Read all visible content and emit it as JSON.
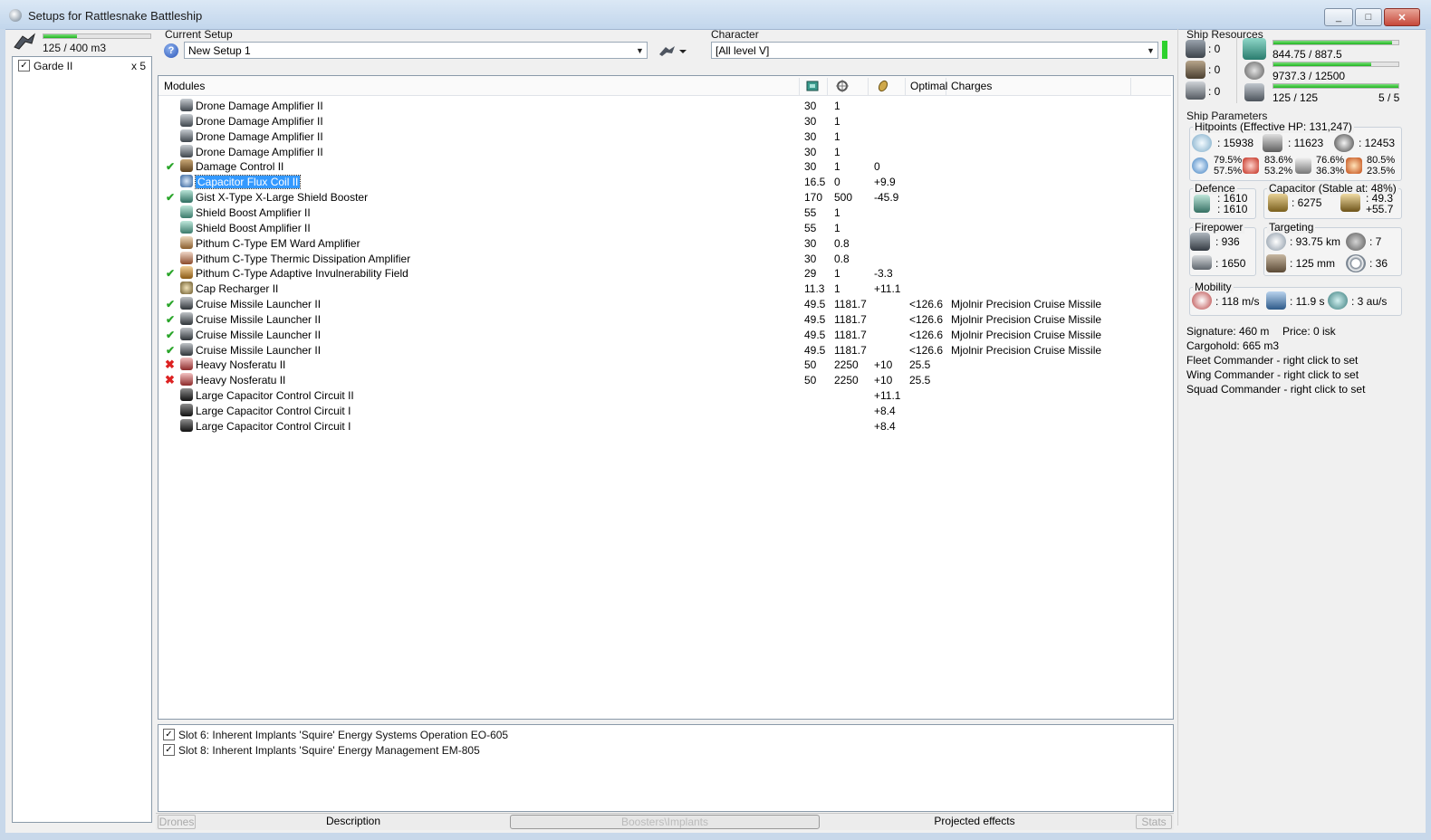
{
  "window": {
    "title": "Setups for Rattlesnake Battleship",
    "min": "_",
    "max": "□",
    "close": "✕"
  },
  "drone_bay": {
    "capacity": "125 / 400 m3",
    "capacity_fraction": 0.3125,
    "items": [
      {
        "name": "Garde II",
        "count": "x 5",
        "checked": true
      }
    ]
  },
  "setup": {
    "label": "Current Setup",
    "value": "New Setup 1"
  },
  "character": {
    "label": "Character",
    "value": "[All level V]"
  },
  "modules": {
    "headers": {
      "modules": "Modules",
      "optimal": "Optimal",
      "charges": "Charges"
    },
    "rows": [
      {
        "status": "",
        "icon": "drone-damage-amplifier-icon",
        "name": "Drone Damage Amplifier II",
        "cpu": "30",
        "pg": "1",
        "cap": "",
        "optimal": "",
        "charge": ""
      },
      {
        "status": "",
        "icon": "drone-damage-amplifier-icon",
        "name": "Drone Damage Amplifier II",
        "cpu": "30",
        "pg": "1",
        "cap": "",
        "optimal": "",
        "charge": ""
      },
      {
        "status": "",
        "icon": "drone-damage-amplifier-icon",
        "name": "Drone Damage Amplifier II",
        "cpu": "30",
        "pg": "1",
        "cap": "",
        "optimal": "",
        "charge": ""
      },
      {
        "status": "",
        "icon": "drone-damage-amplifier-icon",
        "name": "Drone Damage Amplifier II",
        "cpu": "30",
        "pg": "1",
        "cap": "",
        "optimal": "",
        "charge": ""
      },
      {
        "status": "on",
        "icon": "damage-control-icon",
        "name": "Damage Control II",
        "cpu": "30",
        "pg": "1",
        "cap": "0",
        "optimal": "",
        "charge": ""
      },
      {
        "status": "",
        "icon": "capacitor-flux-coil-icon",
        "name": "Capacitor Flux Coil II",
        "cpu": "16.5",
        "pg": "0",
        "cap": "+9.9",
        "optimal": "",
        "charge": "",
        "selected": true
      },
      {
        "status": "on",
        "icon": "shield-booster-icon",
        "name": "Gist X-Type X-Large Shield Booster",
        "cpu": "170",
        "pg": "500",
        "cap": "-45.9",
        "optimal": "",
        "charge": ""
      },
      {
        "status": "",
        "icon": "shield-boost-amplifier-icon",
        "name": "Shield Boost Amplifier II",
        "cpu": "55",
        "pg": "1",
        "cap": "",
        "optimal": "",
        "charge": ""
      },
      {
        "status": "",
        "icon": "shield-boost-amplifier-icon",
        "name": "Shield Boost Amplifier II",
        "cpu": "55",
        "pg": "1",
        "cap": "",
        "optimal": "",
        "charge": ""
      },
      {
        "status": "",
        "icon": "ward-amplifier-icon",
        "name": "Pithum C-Type EM Ward Amplifier",
        "cpu": "30",
        "pg": "0.8",
        "cap": "",
        "optimal": "",
        "charge": ""
      },
      {
        "status": "",
        "icon": "dissipation-amplifier-icon",
        "name": "Pithum C-Type Thermic Dissipation Amplifier",
        "cpu": "30",
        "pg": "0.8",
        "cap": "",
        "optimal": "",
        "charge": ""
      },
      {
        "status": "on",
        "icon": "invulnerability-field-icon",
        "name": "Pithum C-Type Adaptive Invulnerability Field",
        "cpu": "29",
        "pg": "1",
        "cap": "-3.3",
        "optimal": "",
        "charge": ""
      },
      {
        "status": "",
        "icon": "cap-recharger-icon",
        "name": "Cap Recharger II",
        "cpu": "11.3",
        "pg": "1",
        "cap": "+11.1",
        "optimal": "",
        "charge": ""
      },
      {
        "status": "on",
        "icon": "cruise-launcher-icon",
        "name": "Cruise Missile Launcher II",
        "cpu": "49.5",
        "pg": "1181.7",
        "cap": "",
        "optimal": "<126.6",
        "charge": "Mjolnir Precision Cruise Missile"
      },
      {
        "status": "on",
        "icon": "cruise-launcher-icon",
        "name": "Cruise Missile Launcher II",
        "cpu": "49.5",
        "pg": "1181.7",
        "cap": "",
        "optimal": "<126.6",
        "charge": "Mjolnir Precision Cruise Missile"
      },
      {
        "status": "on",
        "icon": "cruise-launcher-icon",
        "name": "Cruise Missile Launcher II",
        "cpu": "49.5",
        "pg": "1181.7",
        "cap": "",
        "optimal": "<126.6",
        "charge": "Mjolnir Precision Cruise Missile"
      },
      {
        "status": "on",
        "icon": "cruise-launcher-icon",
        "name": "Cruise Missile Launcher II",
        "cpu": "49.5",
        "pg": "1181.7",
        "cap": "",
        "optimal": "<126.6",
        "charge": "Mjolnir Precision Cruise Missile"
      },
      {
        "status": "off",
        "icon": "nosferatu-icon",
        "name": "Heavy Nosferatu II",
        "cpu": "50",
        "pg": "2250",
        "cap": "+10",
        "optimal": "25.5",
        "charge": ""
      },
      {
        "status": "off",
        "icon": "nosferatu-icon",
        "name": "Heavy Nosferatu II",
        "cpu": "50",
        "pg": "2250",
        "cap": "+10",
        "optimal": "25.5",
        "charge": ""
      },
      {
        "status": "",
        "icon": "capacitor-control-circuit-icon",
        "name": "Large Capacitor Control Circuit II",
        "cpu": "",
        "pg": "",
        "cap": "+11.1",
        "optimal": "",
        "charge": ""
      },
      {
        "status": "",
        "icon": "capacitor-control-circuit-icon",
        "name": "Large Capacitor Control Circuit I",
        "cpu": "",
        "pg": "",
        "cap": "+8.4",
        "optimal": "",
        "charge": ""
      },
      {
        "status": "",
        "icon": "capacitor-control-circuit-icon",
        "name": "Large Capacitor Control Circuit I",
        "cpu": "",
        "pg": "",
        "cap": "+8.4",
        "optimal": "",
        "charge": ""
      }
    ]
  },
  "implants": [
    {
      "label": "Slot 6: Inherent Implants 'Squire' Energy Systems Operation EO-605",
      "checked": true
    },
    {
      "label": "Slot 8: Inherent Implants 'Squire' Energy Management EM-805",
      "checked": true
    }
  ],
  "bottom_tabs": {
    "drones": "Drones",
    "description": "Description",
    "boosters": "Boosters\\Implants",
    "projected": "Projected effects",
    "stats": "Stats"
  },
  "resources": {
    "title": "Ship Resources",
    "hardpoint_turrets": ": 0",
    "hardpoint_launchers": ": 0",
    "calibration": ": 0",
    "cpu": "844.75 / 887.5",
    "cpu_fraction": 0.952,
    "powergrid": "9737.3 / 12500",
    "powergrid_fraction": 0.779,
    "drone_bandwidth": "125 / 125",
    "drone_bandwidth_fraction": 1.0,
    "drones_active": "5 / 5"
  },
  "params": {
    "title": "Ship Parameters",
    "hitpoints_title": "Hitpoints (Effective HP: 131,247)",
    "shield_hp": ": 15938",
    "armor_hp": ": 11623",
    "structure_hp": ": 12453",
    "res_em_1": "79.5%",
    "res_em_2": "57.5%",
    "res_th_1": "83.6%",
    "res_th_2": "53.2%",
    "res_ki_1": "76.6%",
    "res_ki_2": "36.3%",
    "res_ex_1": "80.5%",
    "res_ex_2": "23.5%",
    "defence_title": "Defence",
    "defence_1": ": 1610",
    "defence_2": ": 1610",
    "capacitor_title": "Capacitor (Stable at: 48%)",
    "capacitor_amount": ": 6275",
    "cap_1": ": 49.3",
    "cap_2": "+55.7",
    "firepower_title": "Firepower",
    "dps": ": 936",
    "volley": ": 1650",
    "targeting_title": "Targeting",
    "range": ": 93.75 km",
    "targets": ": 7",
    "scan_res": ": 125 mm",
    "sensor": ": 36",
    "mobility_title": "Mobility",
    "speed": ": 118 m/s",
    "align": ": 11.9 s",
    "warp": ": 3 au/s",
    "signature": "Signature: 460 m",
    "price": "Price: 0 isk",
    "cargohold": "Cargohold: 665 m3",
    "fleet": "Fleet Commander - right click to set",
    "wing": "Wing Commander - right click to set",
    "squad": "Squad Commander - right click to set"
  }
}
